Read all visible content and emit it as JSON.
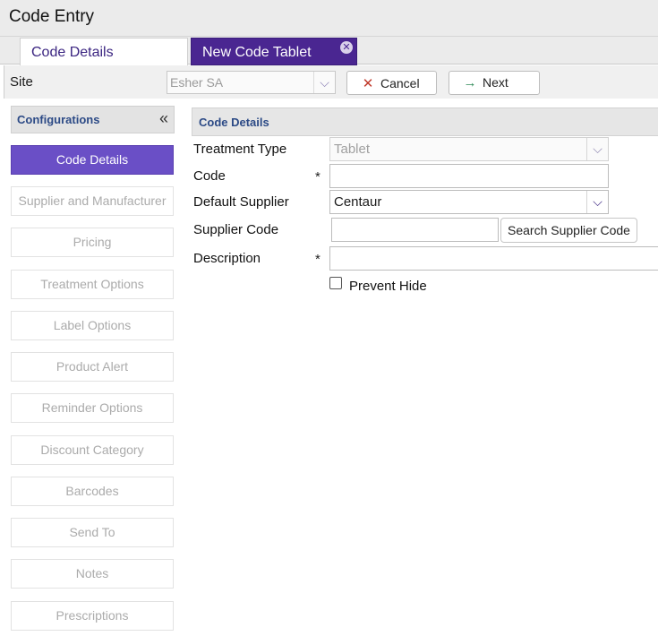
{
  "window": {
    "title": "Code Entry"
  },
  "tabs": [
    {
      "label": "Code Details"
    },
    {
      "label": "New Code Tablet",
      "close_icon": "close-circle-icon"
    }
  ],
  "toolbar": {
    "site_label": "Site",
    "site_value": "Esher SA",
    "cancel_label": "Cancel",
    "cancel_icon": "x-icon",
    "next_label": "Next",
    "next_icon": "arrow-right-icon"
  },
  "sidebar": {
    "title": "Configurations",
    "collapse_icon": "double-chevron-left-icon",
    "items": [
      {
        "label": "Code Details",
        "active": true
      },
      {
        "label": "Supplier and Manufacturer"
      },
      {
        "label": "Pricing"
      },
      {
        "label": "Treatment Options"
      },
      {
        "label": "Label Options"
      },
      {
        "label": "Product Alert"
      },
      {
        "label": "Reminder Options"
      },
      {
        "label": "Discount Category"
      },
      {
        "label": "Barcodes"
      },
      {
        "label": "Send To"
      },
      {
        "label": "Notes"
      },
      {
        "label": "Prescriptions"
      }
    ]
  },
  "form": {
    "section_title": "Code Details",
    "required_marker": "*",
    "treatment_type": {
      "label": "Treatment Type",
      "value": "Tablet"
    },
    "code": {
      "label": "Code",
      "value": ""
    },
    "default_supplier": {
      "label": "Default Supplier",
      "value": "Centaur"
    },
    "supplier_code": {
      "label": "Supplier Code",
      "value": "",
      "search_button": "Search Supplier Code"
    },
    "description": {
      "label": "Description",
      "value": ""
    },
    "prevent_hide": {
      "label": "Prevent Hide",
      "checked": false
    }
  },
  "colors": {
    "accent": "#4a2691",
    "active_nav": "#6a4fc6",
    "section_title": "#2c4a86"
  }
}
